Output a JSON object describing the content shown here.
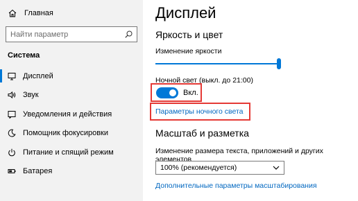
{
  "sidebar": {
    "home_label": "Главная",
    "search_placeholder": "Найти параметр",
    "section_title": "Система",
    "items": [
      {
        "label": "Дисплей",
        "icon": "monitor-icon",
        "active": true
      },
      {
        "label": "Звук",
        "icon": "speaker-icon"
      },
      {
        "label": "Уведомления и действия",
        "icon": "notification-icon"
      },
      {
        "label": "Помощник фокусировки",
        "icon": "moon-icon"
      },
      {
        "label": "Питание и спящий режим",
        "icon": "power-icon"
      },
      {
        "label": "Батарея",
        "icon": "battery-icon"
      }
    ]
  },
  "main": {
    "title": "Дисплей",
    "brightness_section": "Яркость и цвет",
    "brightness_label": "Изменение яркости",
    "brightness_level": 1.0,
    "night_light_label": "Ночной свет (выкл. до 21:00)",
    "night_light_toggle": "Вкл.",
    "night_light_settings_link": "Параметры ночного света",
    "scale_section": "Масштаб и разметка",
    "scale_label": "Изменение размера текста, приложений и других элементов",
    "scale_value": "100% (рекомендуется)",
    "advanced_scale_link": "Дополнительные параметры масштабирования"
  },
  "colors": {
    "accent": "#0078d7",
    "link": "#0067c0",
    "highlight_box": "#e53935"
  }
}
